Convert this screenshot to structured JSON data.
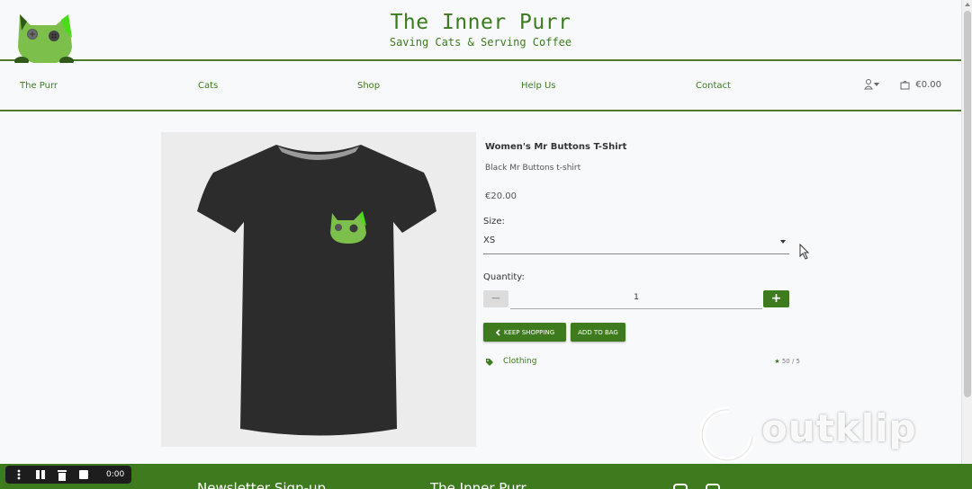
{
  "header": {
    "title": "The Inner Purr",
    "subtitle": "Saving Cats & Serving Coffee"
  },
  "nav": {
    "items": [
      "The Purr",
      "Cats",
      "Shop",
      "Help Us",
      "Contact"
    ],
    "bag_total": "€0.00"
  },
  "product": {
    "name": "Women's Mr Buttons T-Shirt",
    "description": "Black Mr Buttons t-shirt",
    "price": "€20.00",
    "size_label": "Size:",
    "size_value": "XS",
    "quantity_label": "Quantity:",
    "quantity_value": "1",
    "keep_shopping_label": "KEEP SHOPPING",
    "add_to_bag_label": "ADD TO BAG",
    "category": "Clothing",
    "rating": "50 / 5"
  },
  "footer": {
    "newsletter_heading": "Newsletter Sign-up",
    "brand_heading": "The Inner Purr"
  },
  "recorder": {
    "time": "0:00"
  },
  "watermark": {
    "text": "outklip"
  },
  "colors": {
    "brand_green": "#3e7a1e",
    "cat_green": "#7cc04b",
    "bright_green": "#4cdb1a"
  },
  "icons": [
    "cat-logo-icon",
    "user-icon",
    "bag-icon",
    "chevron-left-icon",
    "tag-icon",
    "star-icon",
    "instagram-icon",
    "facebook-icon",
    "menu-dots-icon",
    "pause-icon",
    "trash-icon",
    "stop-icon",
    "cursor-icon"
  ]
}
